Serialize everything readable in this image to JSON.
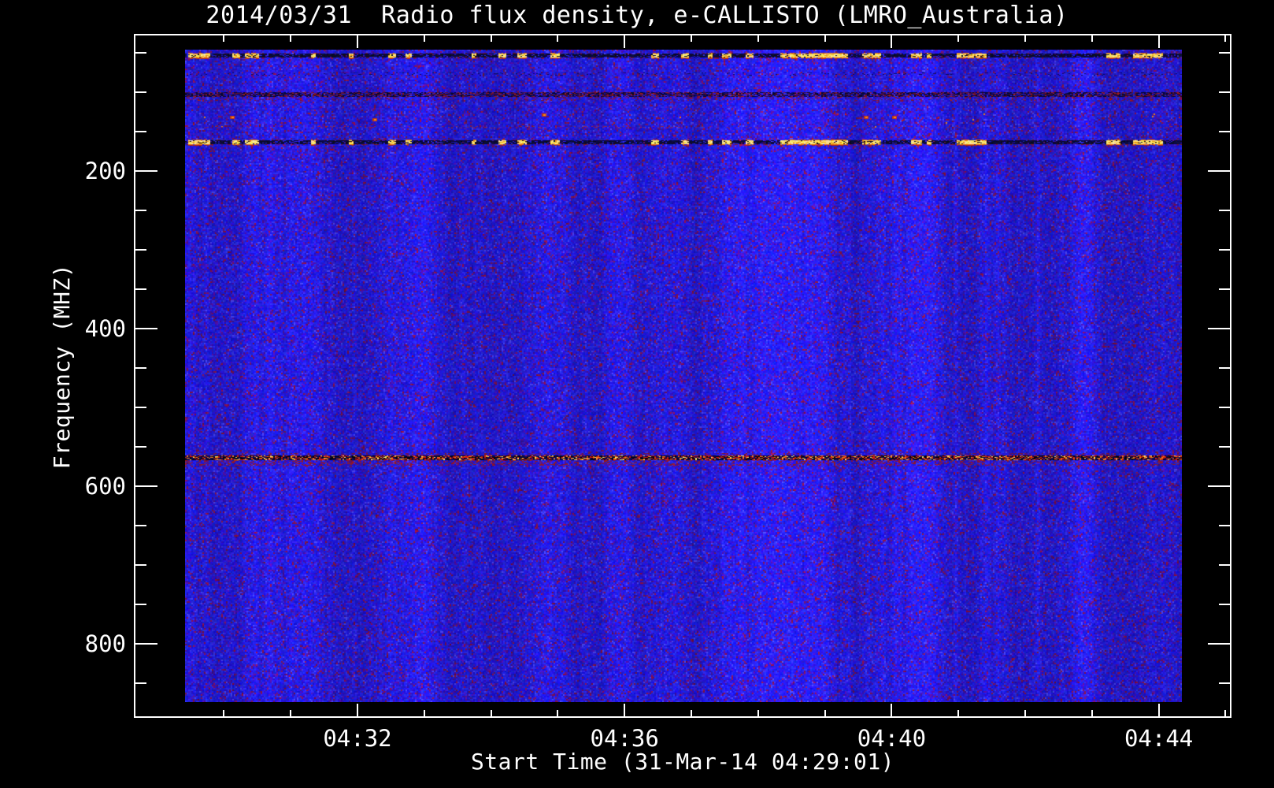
{
  "window": {
    "background": "#000000"
  },
  "chart_data": {
    "type": "heatmap",
    "title": "2014/03/31  Radio flux density, e-CALLISTO (LMRO_Australia)",
    "xlabel": "Start Time (31-Mar-14 04:29:01)",
    "ylabel": "Frequency (MHZ)",
    "x_axis": {
      "date": "31-Mar-14",
      "start_time": "04:29:01",
      "major_tick_labels": [
        "04:32",
        "04:36",
        "04:40",
        "04:44"
      ],
      "major_tick_minutes": [
        32,
        36,
        40,
        44
      ],
      "minor_tick_minutes": [
        30,
        31,
        33,
        34,
        35,
        37,
        38,
        39,
        41,
        42,
        43,
        45
      ],
      "minor_step_minutes": 1
    },
    "y_axis": {
      "unit": "MHZ",
      "major_ticks": [
        200,
        400,
        600,
        800
      ],
      "minor_ticks": [
        50,
        100,
        150,
        250,
        300,
        350,
        450,
        500,
        550,
        650,
        700,
        750,
        850
      ],
      "range_mhz": [
        46,
        874
      ],
      "inverted": true
    },
    "background_description": "quiet solar radio background rendered as bright blue with fine violet/maroon instrumental noise speckle",
    "rfi_bands": [
      {
        "freq_mhz": [
          50,
          57
        ],
        "type": "burst-line",
        "description": "dark carrier line with intermittent saturated yellow/orange bursts"
      },
      {
        "freq_mhz": [
          75,
          78
        ],
        "type": "faint-dark",
        "description": "faint dark interference line with sparse red dots"
      },
      {
        "freq_mhz": [
          100,
          110
        ],
        "type": "dark-speckle",
        "description": "FM broadcast band: dense dark/maroon speckle"
      },
      {
        "freq_mhz": [
          125,
          145
        ],
        "type": "sparse-dots",
        "description": "scattered red interference dots"
      },
      {
        "freq_mhz": [
          143,
          145
        ],
        "type": "faint-line",
        "description": "faint reddish horizontal trace"
      },
      {
        "freq_mhz": [
          158,
          169
        ],
        "type": "burst-line",
        "description": "dark carrier line with intermittent saturated yellow/orange bursts (synchronous with 50-57 MHz band)"
      },
      {
        "freq_mhz": [
          558,
          573
        ],
        "type": "hot-speckle",
        "description": "continuous red/orange/yellow/black speckled interference band"
      }
    ],
    "burst_segments_frac": [
      [
        0.002,
        0.024
      ],
      [
        0.047,
        0.055
      ],
      [
        0.06,
        0.073
      ],
      [
        0.126,
        0.13
      ],
      [
        0.163,
        0.168
      ],
      [
        0.203,
        0.211
      ],
      [
        0.221,
        0.227
      ],
      [
        0.287,
        0.291
      ],
      [
        0.314,
        0.322
      ],
      [
        0.332,
        0.342
      ],
      [
        0.366,
        0.375
      ],
      [
        0.467,
        0.474
      ],
      [
        0.497,
        0.505
      ],
      [
        0.524,
        0.528
      ],
      [
        0.538,
        0.547
      ],
      [
        0.561,
        0.569
      ],
      [
        0.596,
        0.664
      ],
      [
        0.679,
        0.697
      ],
      [
        0.728,
        0.739
      ],
      [
        0.743,
        0.748
      ],
      [
        0.774,
        0.803
      ],
      [
        0.923,
        0.937
      ],
      [
        0.95,
        0.98
      ],
      [
        0.999,
        1.0
      ]
    ],
    "hot_spots": [
      {
        "time_frac": 0.047,
        "freq_mhz": 131
      },
      {
        "time_frac": 0.19,
        "freq_mhz": 134
      },
      {
        "time_frac": 0.36,
        "freq_mhz": 128
      },
      {
        "time_frac": 0.683,
        "freq_mhz": 131
      },
      {
        "time_frac": 0.711,
        "freq_mhz": 131
      }
    ]
  },
  "colors": {
    "background": "#000000",
    "axis": "#ffffff",
    "base_blue": "#2a1cf0",
    "noise_violet": "#5a10a0",
    "noise_maroon": "#801538",
    "burst_yellow": "#ffe44a",
    "burst_orange": "#f08014",
    "burst_red": "#c8280f",
    "band_dark": "#050508"
  }
}
